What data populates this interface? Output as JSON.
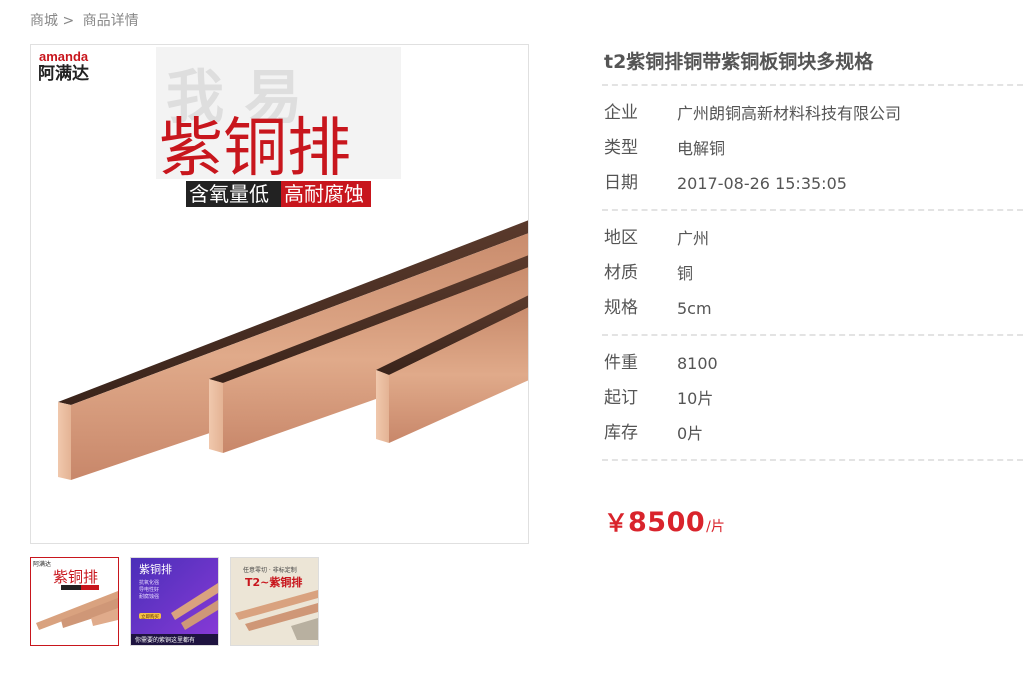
{
  "breadcrumb": {
    "home": "商城",
    "sep": ">",
    "current": "商品详情"
  },
  "product": {
    "title": "t2紫铜排铜带紫铜板铜块多规格",
    "image": {
      "brand_en": "amanda",
      "brand_cn": "阿满达",
      "watermark": "我 易",
      "headline": "紫铜排",
      "tag1": "含氧量低",
      "tag2": "高耐腐蚀"
    },
    "thumbs": [
      {
        "headline": "紫铜排",
        "brand_cn": "阿满达"
      },
      {
        "headline": "紫铜排",
        "lines": [
          "抗氧化强",
          "导电性好",
          "耐腐蚀强"
        ],
        "button": "立即购买",
        "footer": "你需要的紫铜这里都有"
      },
      {
        "banner": "任意零切 · 非标定制",
        "headline": "T2~紫铜排"
      }
    ],
    "groups": [
      [
        {
          "key": "企业",
          "value": "广州朗铜高新材料科技有限公司"
        },
        {
          "key": "类型",
          "value": "电解铜"
        },
        {
          "key": "日期",
          "value": "2017-08-26 15:35:05"
        }
      ],
      [
        {
          "key": "地区",
          "value": "广州"
        },
        {
          "key": "材质",
          "value": "铜"
        },
        {
          "key": "规格",
          "value": "5cm"
        }
      ],
      [
        {
          "key": "件重",
          "value": "8100"
        },
        {
          "key": "起订",
          "value": "10片"
        },
        {
          "key": "库存",
          "value": "0片"
        }
      ]
    ],
    "price": {
      "currency": "￥",
      "amount": "8500",
      "unit": "/片"
    }
  },
  "colors": {
    "accent": "#d9242c",
    "copper": "#d9a27f",
    "divider": "#e3e3e3"
  }
}
